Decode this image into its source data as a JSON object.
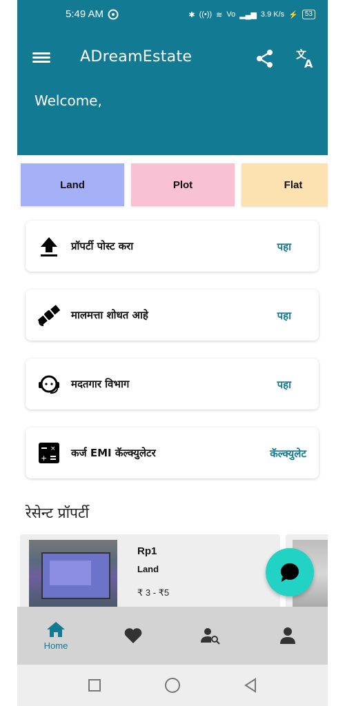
{
  "status_bar": {
    "time": "5:49 AM",
    "speed": "3.9 K/s",
    "battery": "53"
  },
  "header": {
    "title": "ADreamEstate",
    "welcome": "Welcome,"
  },
  "categories": [
    "Land",
    "Plot",
    "Flat"
  ],
  "actions": [
    {
      "label": "प्रॉपर्टी पोस्ट करा",
      "action": "पहा",
      "icon": "upload-icon"
    },
    {
      "label": "मालमत्ता शोधत आहे",
      "action": "पहा",
      "icon": "satellite-icon"
    },
    {
      "label": "मदतगार विभाग",
      "action": "पहा",
      "icon": "support-agent-icon"
    },
    {
      "label": "कर्ज EMI कॅल्क्युलेटर",
      "action": "कॅल्क्युलेट",
      "icon": "calculator-icon"
    }
  ],
  "recent": {
    "title": "रेसेन्ट प्रॉपर्टी",
    "items": [
      {
        "name": "Rp1",
        "type": "Land",
        "price": "₹ 3 - ₹5"
      }
    ]
  },
  "bottom_nav": {
    "home_label": "Home"
  },
  "colors": {
    "primary": "#137a93",
    "fab": "#22d3c5",
    "land": "#a6b0f7",
    "plot": "#f9c1d4",
    "flat": "#fce2b0"
  }
}
